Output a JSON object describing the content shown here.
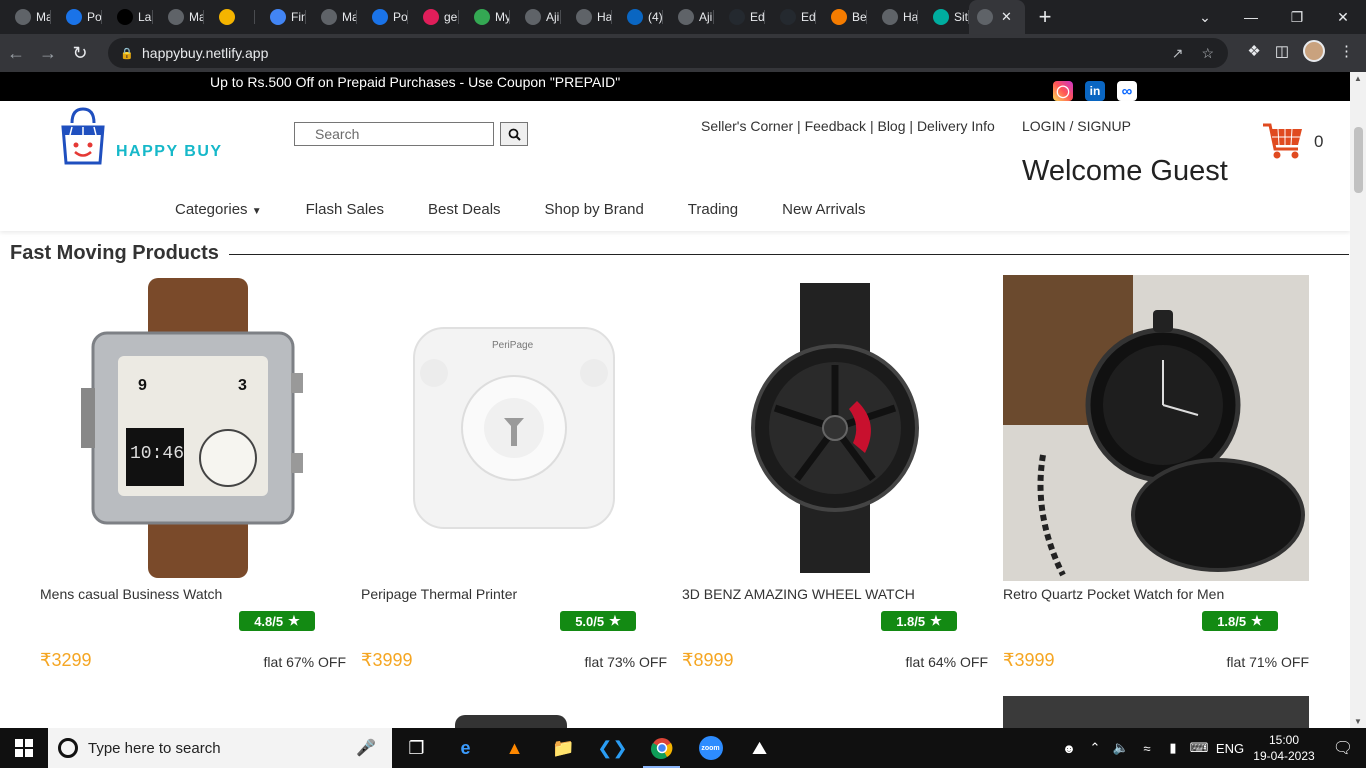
{
  "browser": {
    "tabs": [
      {
        "title": "Ma",
        "icon": "globe-icon",
        "color": "#5f6368"
      },
      {
        "title": "Po",
        "icon": "zoho-icon",
        "color": "#1a73e8"
      },
      {
        "title": "La",
        "icon": "m-icon",
        "color": "#000000"
      },
      {
        "title": "Ma",
        "icon": "globe-icon",
        "color": "#5f6368"
      },
      {
        "title": "",
        "icon": "grid-icon",
        "color": "#f4b400"
      },
      {
        "title": "Fin",
        "icon": "flag-icon",
        "color": "#4285f4"
      },
      {
        "title": "Ma",
        "icon": "globe-icon",
        "color": "#5f6368"
      },
      {
        "title": "Po",
        "icon": "zoho-icon",
        "color": "#1a73e8"
      },
      {
        "title": "ge",
        "icon": "slack-icon",
        "color": "#e01e5a"
      },
      {
        "title": "My",
        "icon": "drive-icon",
        "color": "#34a853"
      },
      {
        "title": "Aji",
        "icon": "globe-icon",
        "color": "#5f6368"
      },
      {
        "title": "Ha",
        "icon": "globe-icon",
        "color": "#5f6368"
      },
      {
        "title": "(4)",
        "icon": "linkedin-icon",
        "color": "#0a66c2"
      },
      {
        "title": "Aji",
        "icon": "globe-icon",
        "color": "#5f6368"
      },
      {
        "title": "Ed",
        "icon": "github-icon",
        "color": "#24292f"
      },
      {
        "title": "Ed",
        "icon": "github-icon",
        "color": "#24292f"
      },
      {
        "title": "Be",
        "icon": "diamond-icon",
        "color": "#f57c00"
      },
      {
        "title": "Ha",
        "icon": "globe-icon",
        "color": "#5f6368"
      },
      {
        "title": "Sit",
        "icon": "netlify-icon",
        "color": "#00ad9f"
      }
    ],
    "url": "happybuy.netlify.app"
  },
  "site": {
    "promo": "Up to Rs.500 Off on Prepaid Purchases - Use Coupon \"PREPAID\"",
    "logo_text": "HAPPY BUY",
    "search_placeholder": "Search",
    "links": {
      "sellers": "Seller's Corner",
      "feedback": "Feedback",
      "blog": "Blog",
      "delivery": "Delivery Info",
      "sep": "|"
    },
    "login": "LOGIN / SIGNUP",
    "welcome": "Welcome Guest",
    "cart_count": "0",
    "menu": {
      "categories": "Categories",
      "flash": "Flash Sales",
      "best": "Best Deals",
      "brand": "Shop by Brand",
      "trading": "Trading",
      "arrivals": "New Arrivals"
    },
    "section_title": "Fast Moving Products",
    "products": [
      {
        "name": "Mens casual Business Watch",
        "rating": "4.8/5",
        "price": "₹3299",
        "discount": "flat 67% OFF"
      },
      {
        "name": "Peripage Thermal Printer",
        "rating": "5.0/5",
        "price": "₹3999",
        "discount": "flat 73% OFF",
        "brand_mark": "PeriPage"
      },
      {
        "name": "3D BENZ AMAZING WHEEL WATCH",
        "rating": "1.8/5",
        "price": "₹8999",
        "discount": "flat 64% OFF"
      },
      {
        "name": "Retro Quartz Pocket Watch for Men",
        "rating": "1.8/5",
        "price": "₹3999",
        "discount": "flat 71% OFF"
      }
    ]
  },
  "taskbar": {
    "search_placeholder": "Type here to search",
    "lang": "ENG",
    "time": "15:00",
    "date": "19-04-2023"
  },
  "colors": {
    "accent": "#16b8c9",
    "rating_bg": "#138a13",
    "price": "#f5a623"
  }
}
